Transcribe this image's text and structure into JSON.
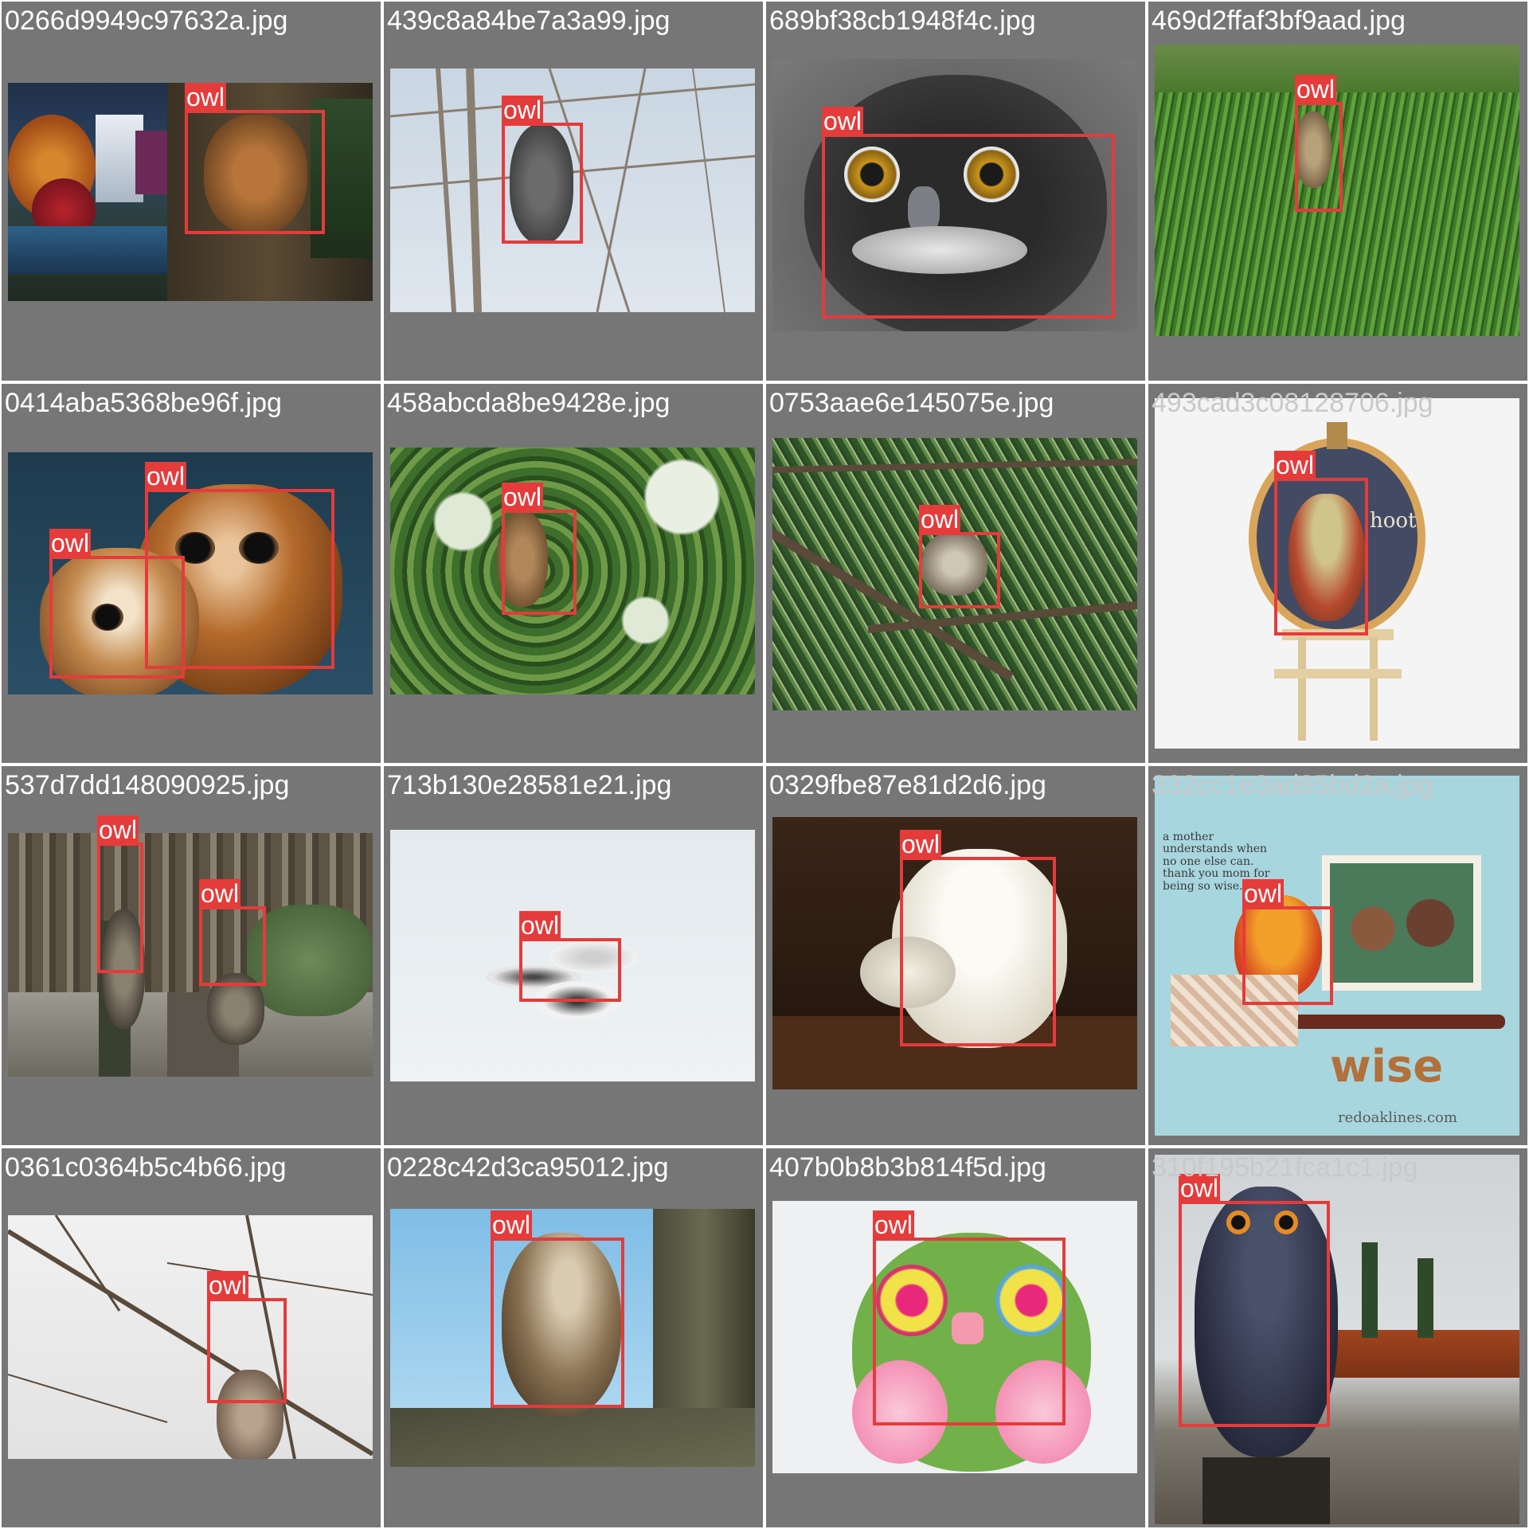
{
  "grid": {
    "background": "#767676",
    "box_color": "#e53b3b",
    "tiles": [
      {
        "filename": "0266d9949c97632a.jpg",
        "scene": "fantasy-forest",
        "detections": [
          {
            "label": "owl"
          }
        ]
      },
      {
        "filename": "439c8a84be7a3a99.jpg",
        "scene": "bare-branches",
        "detections": [
          {
            "label": "owl"
          }
        ]
      },
      {
        "filename": "689bf38cb1948f4c.jpg",
        "scene": "spectacled-owl-closeup",
        "detections": [
          {
            "label": "owl"
          }
        ]
      },
      {
        "filename": "469d2ffaf3bf9aad.jpg",
        "scene": "grass-field",
        "detections": [
          {
            "label": "owl"
          }
        ]
      },
      {
        "filename": "0414aba5368be96f.jpg",
        "scene": "tawny-owls-pair",
        "detections": [
          {
            "label": "owl"
          },
          {
            "label": "owl"
          }
        ]
      },
      {
        "filename": "458abcda8be9428e.jpg",
        "scene": "green-tree",
        "detections": [
          {
            "label": "owl"
          }
        ]
      },
      {
        "filename": "0753aae6e145075e.jpg",
        "scene": "pine-branch",
        "detections": [
          {
            "label": "owl"
          }
        ]
      },
      {
        "filename": "493cad3c08128706.jpg",
        "scene": "embroidery-hoop",
        "faint": true,
        "detections": [
          {
            "label": "owl"
          }
        ]
      },
      {
        "filename": "537d7dd148090925.jpg",
        "scene": "barred-owls-enclosure",
        "detections": [
          {
            "label": "owl"
          },
          {
            "label": "owl"
          }
        ]
      },
      {
        "filename": "713b130e28581e21.jpg",
        "scene": "snowy-owl-flight",
        "detections": [
          {
            "label": "owl"
          }
        ]
      },
      {
        "filename": "0329fbe87e81d2d6.jpg",
        "scene": "snowy-owl-perch",
        "detections": [
          {
            "label": "owl"
          }
        ]
      },
      {
        "filename": "332cc1e3ad85bd2a.jpg",
        "scene": "scrapbook",
        "faint": true,
        "detections": [
          {
            "label": "owl"
          }
        ]
      },
      {
        "filename": "0361c0364b5c4b66.jpg",
        "scene": "snowy-branches",
        "detections": [
          {
            "label": "owl"
          }
        ]
      },
      {
        "filename": "0228c42d3ca95012.jpg",
        "scene": "burrowing-owl-sky",
        "detections": [
          {
            "label": "owl"
          }
        ]
      },
      {
        "filename": "407b0b8b3b814f5d.jpg",
        "scene": "clay-owl",
        "detections": [
          {
            "label": "owl"
          }
        ]
      },
      {
        "filename": "310f195b21fca1c1.jpg",
        "scene": "owl-statue",
        "faint": true,
        "detections": [
          {
            "label": "owl"
          }
        ]
      }
    ]
  },
  "scrapbook": {
    "note": "a mother understands when no one else can. thank you mom for being so wise.",
    "word": "wise",
    "credit": "redoaklines.com"
  },
  "embroidery": {
    "word": "hoot"
  }
}
